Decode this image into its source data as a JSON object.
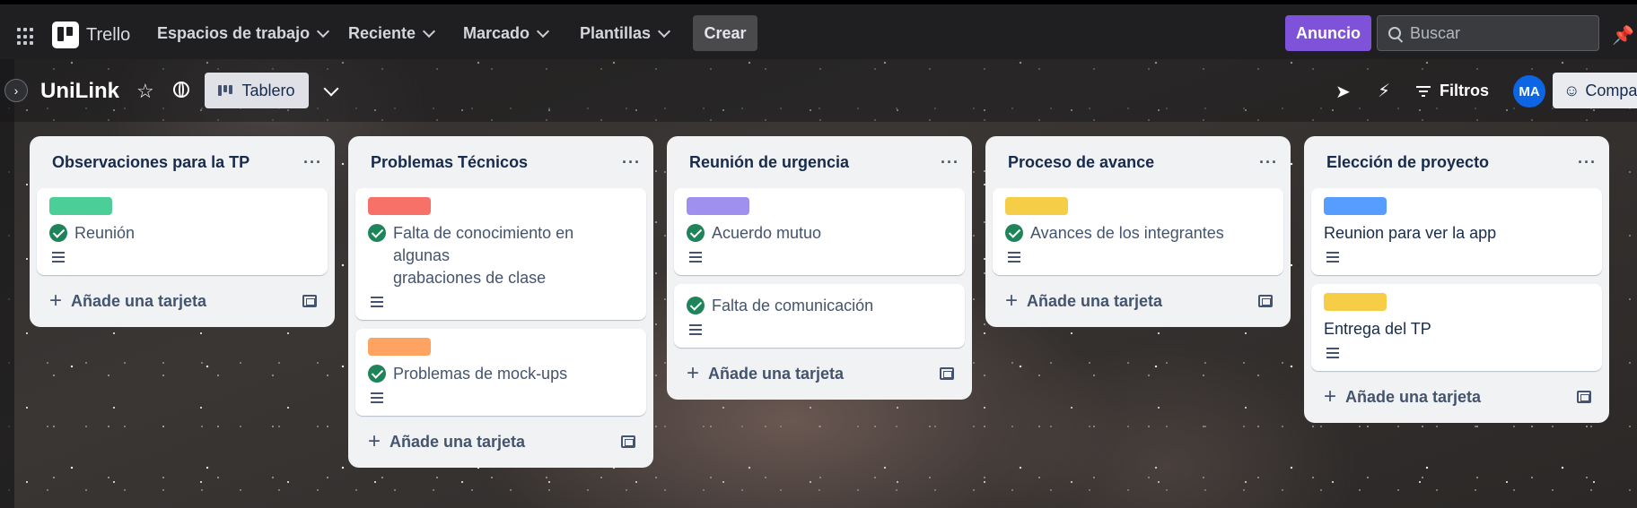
{
  "topbar": {
    "logo_text": "Trello",
    "nav": [
      "Espacios de trabajo",
      "Reciente",
      "Marcado",
      "Plantillas"
    ],
    "create_label": "Crear",
    "announce_label": "Anuncio",
    "search_placeholder": "Buscar"
  },
  "board": {
    "title": "UniLink",
    "view_label": "Tablero",
    "filters_label": "Filtros",
    "avatar_initials": "MA",
    "share_label": "Compar"
  },
  "add_card_label": "Añade una tarjeta",
  "lists": [
    {
      "title": "Observaciones para la TP",
      "cards": [
        {
          "label_color": "#4bce97",
          "title_lines": [
            "Reunión"
          ],
          "done": true
        }
      ]
    },
    {
      "title": "Problemas Técnicos",
      "cards": [
        {
          "label_color": "#f87168",
          "title_lines": [
            "Falta de conocimiento en algunas",
            "grabaciones de clase"
          ],
          "done": true
        },
        {
          "label_color": "#fea362",
          "title_lines": [
            "Problemas de mock-ups"
          ],
          "done": true
        }
      ]
    },
    {
      "title": "Reunión de urgencia",
      "cards": [
        {
          "label_color": "#9f8fef",
          "title_lines": [
            "Acuerdo mutuo"
          ],
          "done": true
        },
        {
          "label_color": null,
          "title_lines": [
            "Falta de comunicación"
          ],
          "done": true
        }
      ]
    },
    {
      "title": "Proceso de avance",
      "cards": [
        {
          "label_color": "#f5cd47",
          "title_lines": [
            "Avances de los integrantes"
          ],
          "done": true
        }
      ]
    },
    {
      "title": "Elección de proyecto",
      "cards": [
        {
          "label_color": "#579dff",
          "title_lines": [
            "Reunion para ver la app"
          ],
          "done": false
        },
        {
          "label_color": "#f5cd47",
          "title_lines": [
            "Entrega del TP"
          ],
          "done": false
        }
      ]
    }
  ]
}
